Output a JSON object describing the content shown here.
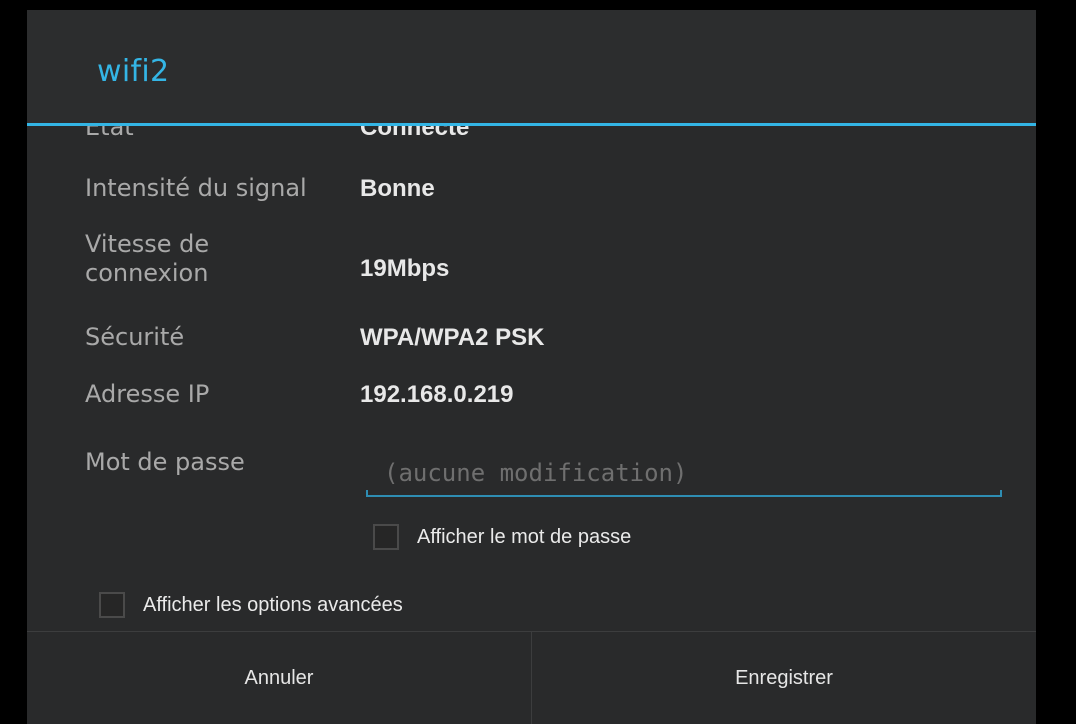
{
  "dialog": {
    "title": "wifi2",
    "accent_color": "#33b5e5"
  },
  "details": [
    {
      "label": "État",
      "value": "Connecté"
    },
    {
      "label": "Intensité du signal",
      "value": "Bonne"
    },
    {
      "label": "Vitesse de connexion",
      "value": "19Mbps"
    },
    {
      "label": "Sécurité",
      "value": "WPA/WPA2 PSK"
    },
    {
      "label": "Adresse IP",
      "value": "192.168.0.219"
    }
  ],
  "password": {
    "label": "Mot de passe",
    "placeholder": "(aucune modification)",
    "value": ""
  },
  "show_password": {
    "label": "Afficher le mot de passe",
    "checked": false
  },
  "advanced_options": {
    "label": "Afficher les options avancées",
    "checked": false
  },
  "buttons": {
    "cancel": "Annuler",
    "save": "Enregistrer"
  }
}
